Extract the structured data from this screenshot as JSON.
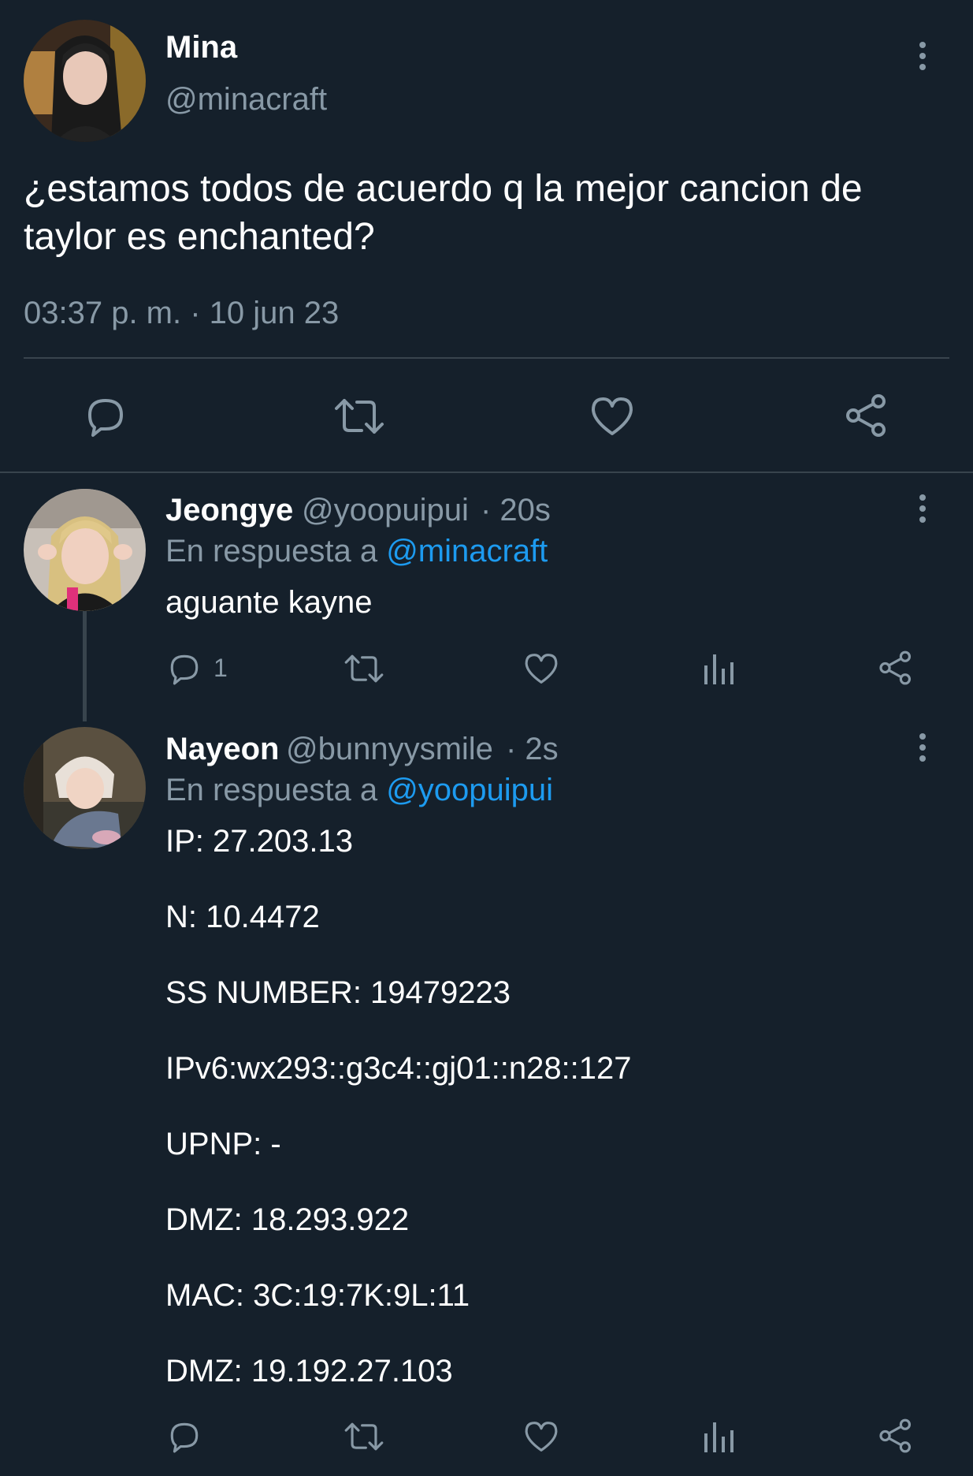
{
  "main_tweet": {
    "name": "Mina",
    "handle": "@minacraft",
    "text_line1": "¿estamos todos de acuerdo q la mejor cancion de",
    "text_line2": "taylor es enchanted?",
    "timestamp": "03:37 p. m. · 10 jun 23"
  },
  "reply1": {
    "name": "Jeongye",
    "handle": "@yoopuipui",
    "time": "· 20s",
    "replying_prefix": "En respuesta a",
    "replying_to": "@minacraft",
    "text": "aguante kayne",
    "reply_count": "1"
  },
  "reply2": {
    "name": "Nayeon",
    "handle": "@bunnyysmile",
    "time": "· 2s",
    "replying_prefix": "En respuesta a",
    "replying_to": "@yoopuipui",
    "lines": [
      "IP: 27.203.13",
      "N: 10.4472",
      "SS NUMBER: 19479223",
      "IPv6:wx293::g3c4::gj01::n28::127",
      "UPNP: -",
      "DMZ: 18.293.922",
      "MAC: 3C:19:7K:9L:11",
      "DMZ: 19.192.27.103"
    ]
  },
  "icons": {
    "reply": "reply-icon",
    "retweet": "retweet-icon",
    "like": "heart-icon",
    "views": "views-icon",
    "share": "share-icon",
    "more": "more-vertical-icon"
  },
  "colors": {
    "background": "#15202b",
    "divider": "#38444d",
    "secondary_text": "#8899a6",
    "link": "#1d9bf0"
  }
}
